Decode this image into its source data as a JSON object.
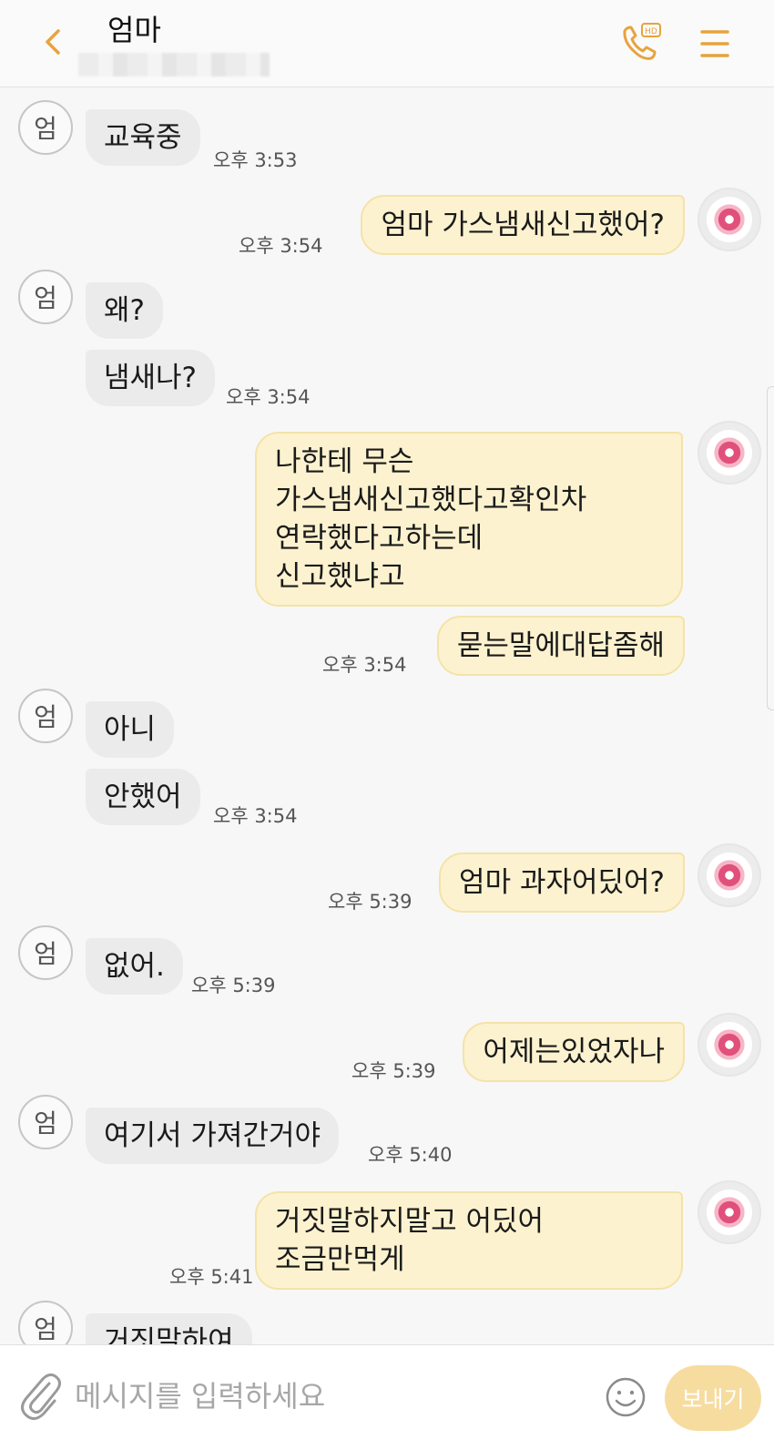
{
  "header": {
    "title": "엄마",
    "call_badge": "HD"
  },
  "contact_avatar_initial": "엄",
  "messages": [
    {
      "side": "in",
      "text": "교육중",
      "time": "오후 3:53"
    },
    {
      "side": "out",
      "text": "엄마 가스냄새신고했어?",
      "time": "오후 3:54"
    },
    {
      "side": "in",
      "text": "왜?",
      "time": ""
    },
    {
      "side": "in",
      "text": "냄새나?",
      "time": "오후 3:54"
    },
    {
      "side": "out",
      "text": "나한테 무슨\n가스냄새신고했다고확인차\n연락했다고하는데\n신고했냐고",
      "time": ""
    },
    {
      "side": "out",
      "text": "묻는말에대답좀해",
      "time": "오후 3:54"
    },
    {
      "side": "in",
      "text": "아니",
      "time": ""
    },
    {
      "side": "in",
      "text": "안했어",
      "time": "오후 3:54"
    },
    {
      "side": "out",
      "text": "엄마 과자어딨어?",
      "time": "오후 5:39"
    },
    {
      "side": "in",
      "text": "없어.",
      "time": "오후 5:39"
    },
    {
      "side": "out",
      "text": "어제는있었자나",
      "time": "오후 5:39"
    },
    {
      "side": "in",
      "text": "여기서 가져간거야",
      "time": "오후 5:40"
    },
    {
      "side": "out",
      "text": "거짓말하지말고 어딨어\n조금만먹게",
      "time": "오후 5:41"
    },
    {
      "side": "in",
      "text": "거짓말하여",
      "time": ""
    }
  ],
  "input": {
    "placeholder": "메시지를 입력하세요",
    "value": "",
    "send_label": "보내기"
  },
  "colors": {
    "accent": "#e8a33c",
    "incoming_bubble": "#ebebeb",
    "outgoing_bubble": "#fdf2cf",
    "send_button": "#f7dca0"
  }
}
